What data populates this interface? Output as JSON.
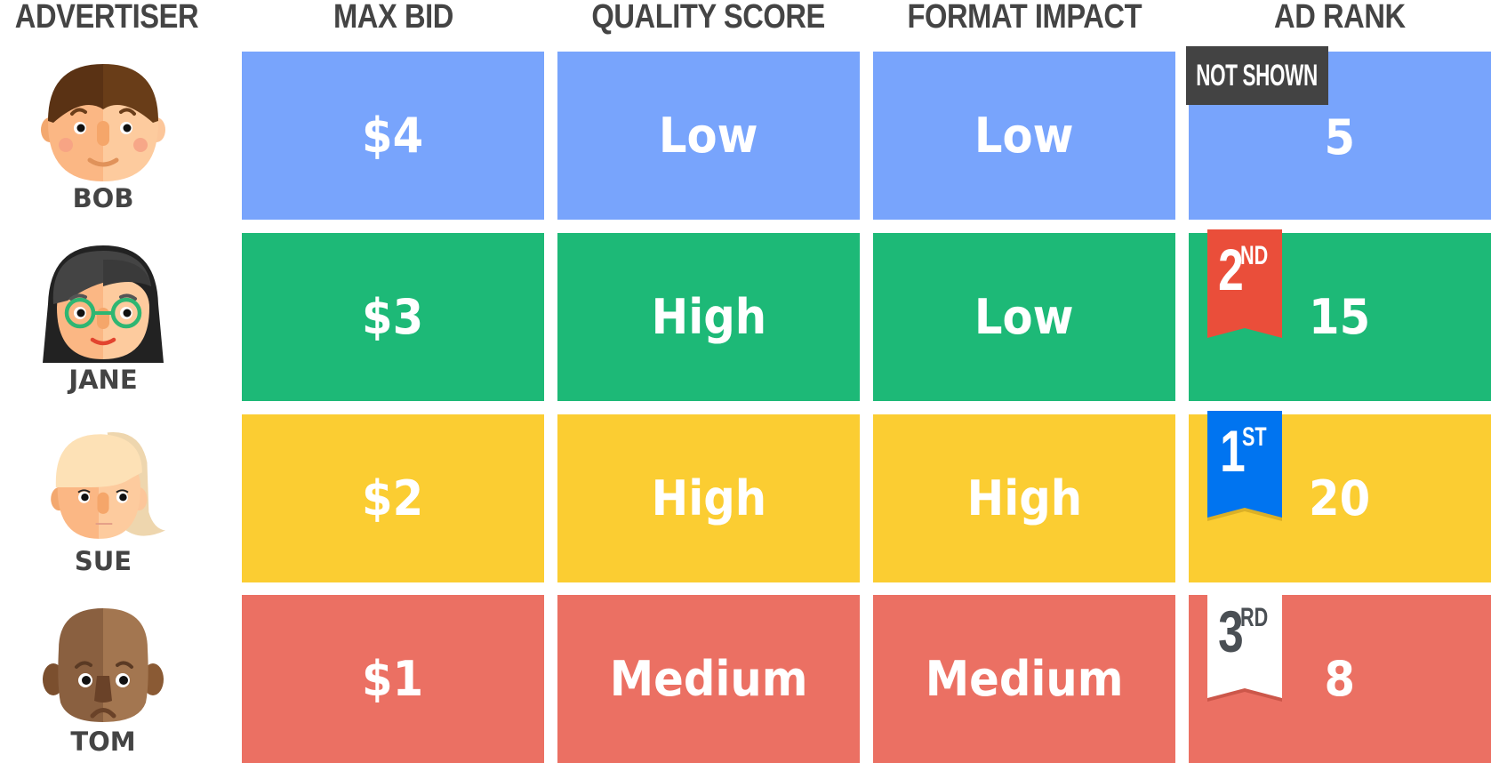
{
  "headers": {
    "advertiser": "ADVERTISER",
    "max_bid": "MAX BID",
    "quality_score": "QUALITY SCORE",
    "format_impact": "FORMAT IMPACT",
    "ad_rank": "AD RANK"
  },
  "colors": {
    "row_blue": "#78A4FC",
    "row_green": "#1DB977",
    "row_yellow": "#FBCD32",
    "row_red": "#EB7063",
    "header_text": "#444444",
    "badge_dark": "#434343",
    "ribbon_red": "#EA4E3A",
    "ribbon_blue": "#0074F0",
    "ribbon_white": "#FFFFFF"
  },
  "rows": [
    {
      "advertiser": "BOB",
      "avatar": "bob-face-icon",
      "max_bid": "$4",
      "quality_score": "Low",
      "format_impact": "Low",
      "ad_rank": "5",
      "position_badge": {
        "type": "label",
        "text": "NOT SHOWN"
      }
    },
    {
      "advertiser": "JANE",
      "avatar": "jane-face-icon",
      "max_bid": "$3",
      "quality_score": "High",
      "format_impact": "Low",
      "ad_rank": "15",
      "position_badge": {
        "type": "ribbon",
        "number": "2",
        "suffix": "ND"
      }
    },
    {
      "advertiser": "SUE",
      "avatar": "sue-face-icon",
      "max_bid": "$2",
      "quality_score": "High",
      "format_impact": "High",
      "ad_rank": "20",
      "position_badge": {
        "type": "ribbon",
        "number": "1",
        "suffix": "ST"
      }
    },
    {
      "advertiser": "TOM",
      "avatar": "tom-face-icon",
      "max_bid": "$1",
      "quality_score": "Medium",
      "format_impact": "Medium",
      "ad_rank": "8",
      "position_badge": {
        "type": "ribbon",
        "number": "3",
        "suffix": "RD"
      }
    }
  ]
}
